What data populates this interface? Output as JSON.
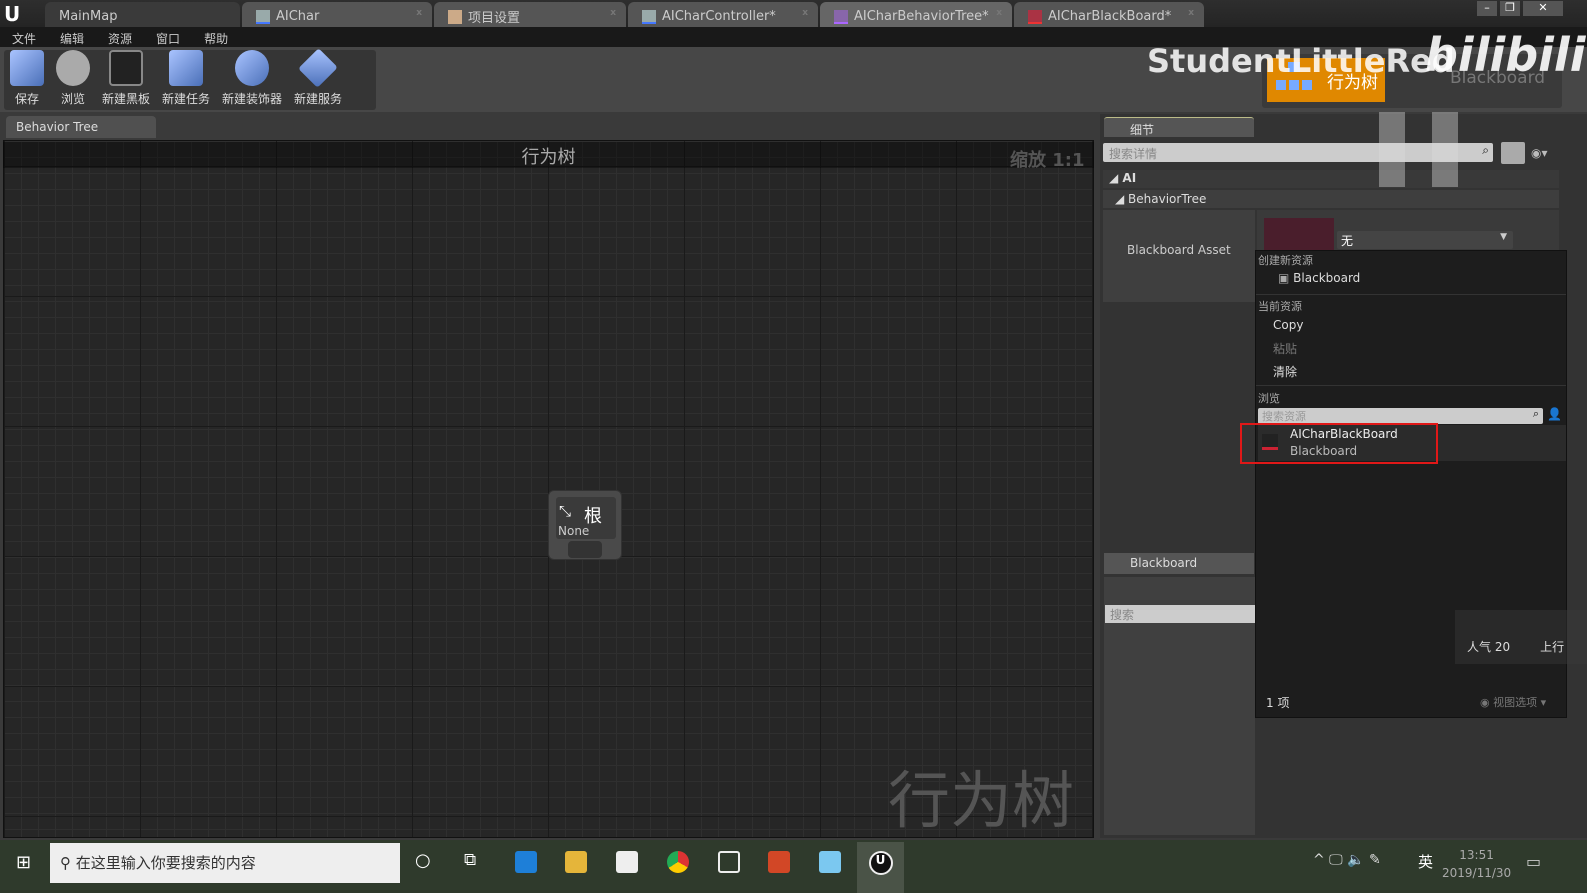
{
  "titlebar": {
    "tabs": [
      "MainMap",
      "AIChar",
      "项目设置",
      "AICharController*",
      "AICharBehaviorTree*",
      "AICharBlackBoard*"
    ]
  },
  "menu": [
    "文件",
    "编辑",
    "资源",
    "窗口",
    "帮助"
  ],
  "toolbar": [
    "保存",
    "浏览",
    "新建黑板",
    "新建任务",
    "新建装饰器",
    "新建服务"
  ],
  "watermark": {
    "user": "StudentLittleRed",
    "site": "bilibili"
  },
  "modes": {
    "behavior_tree": "行为树",
    "blackboard": "Blackboard",
    "active_color": "#e08800"
  },
  "editor_tab": "Behavior Tree",
  "graph": {
    "title": "行为树",
    "zoom": "缩放 1:1",
    "watermark": "行为树",
    "root_node": {
      "title": "根",
      "subtitle": "None"
    }
  },
  "details": {
    "tab": "细节",
    "search_placeholder": "搜索详情",
    "category": "AI",
    "subcategory": "BehaviorTree",
    "property": "Blackboard Asset",
    "value": "无"
  },
  "popup": {
    "create_header": "创建新资源",
    "create_item": "Blackboard",
    "current_header": "当前资源",
    "copy": "Copy",
    "paste": "粘贴",
    "clear": "清除",
    "browse_header": "浏览",
    "search_placeholder": "搜索资源",
    "result_name": "AICharBlackBoard",
    "result_type": "Blackboard",
    "count": "1 项",
    "view_options": "视图选项"
  },
  "blackboard_panel": {
    "tab": "Blackboard",
    "search_placeholder": "搜索"
  },
  "overlay": {
    "popularity": "人气 20",
    "cut": "上行"
  },
  "taskbar": {
    "search_placeholder": "在这里输入你要搜索的内容",
    "ime": "英",
    "time": "13:51",
    "date": "2019/11/30"
  }
}
